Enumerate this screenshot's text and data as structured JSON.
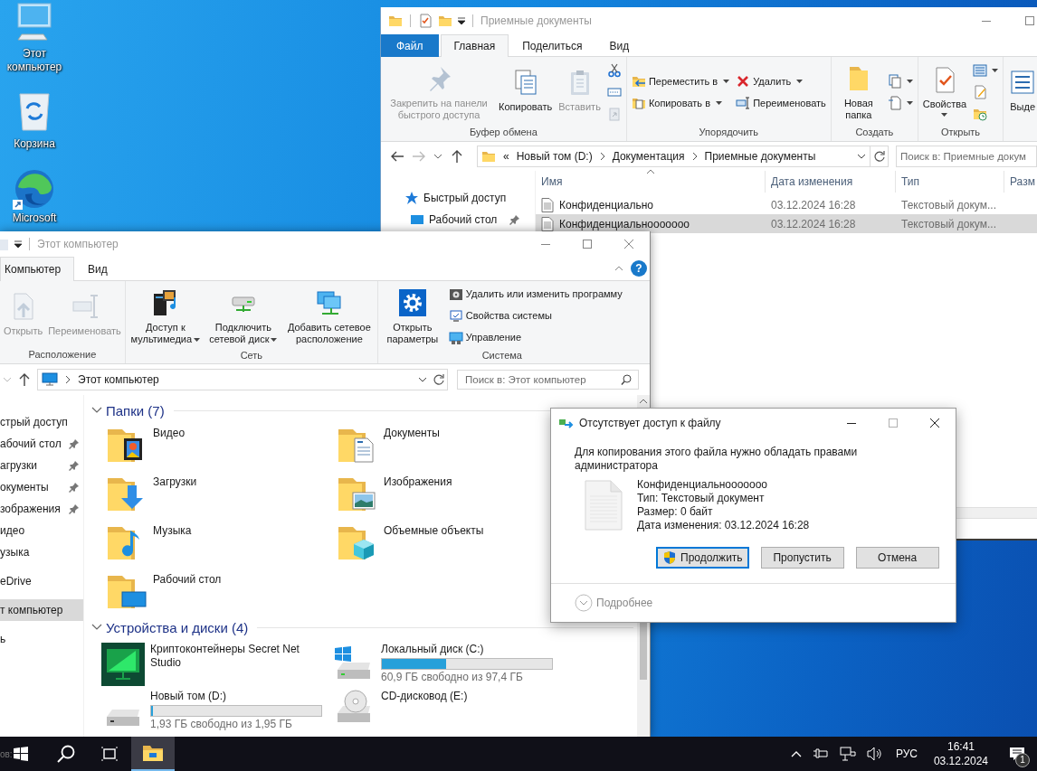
{
  "desktop": {
    "icons": [
      {
        "label": "Этот компьютер",
        "kind": "computer"
      },
      {
        "label": "Корзина",
        "kind": "bin"
      },
      {
        "label": "Microsoft",
        "kind": "browser"
      }
    ]
  },
  "documents_window": {
    "title": "Приемные документы",
    "tabs": [
      {
        "label": "Файл",
        "kind": "file",
        "selected": false
      },
      {
        "label": "Главная",
        "kind": "tab",
        "selected": true
      },
      {
        "label": "Поделиться",
        "kind": "tab",
        "selected": false
      },
      {
        "label": "Вид",
        "kind": "tab",
        "selected": false
      }
    ],
    "ribbon": [
      {
        "label": "Буфер обмена",
        "columns": [
          [
            {
              "kind": "large",
              "label": "Закрепить на панели быстрого доступа",
              "disabled": true,
              "menu": false
            }
          ],
          [
            {
              "kind": "large",
              "label": "Копировать",
              "disabled": false,
              "menu": false
            }
          ],
          [
            {
              "kind": "large",
              "label": "Вставить",
              "disabled": true,
              "menu": false
            }
          ],
          [
            {
              "kind": "icon",
              "disabled": false,
              "menu": false
            },
            {
              "kind": "icon",
              "disabled": false,
              "menu": false
            },
            {
              "kind": "icon",
              "disabled": true,
              "menu": false
            }
          ]
        ]
      },
      {
        "label": "Упорядочить",
        "columns": [
          [
            {
              "kind": "small",
              "label": "Переместить в",
              "disabled": false,
              "menu": true
            },
            {
              "kind": "small",
              "label": "Копировать в",
              "disabled": false,
              "menu": true
            }
          ],
          [
            {
              "kind": "small",
              "label": "Удалить",
              "disabled": false,
              "menu": true
            },
            {
              "kind": "small",
              "label": "Переименовать",
              "disabled": false,
              "menu": false
            }
          ]
        ]
      },
      {
        "label": "Создать",
        "columns": [
          [
            {
              "kind": "large",
              "label": "Новая папка",
              "disabled": false,
              "menu": false
            }
          ],
          [
            {
              "kind": "icon",
              "disabled": false,
              "menu": true
            },
            {
              "kind": "icon",
              "disabled": false,
              "menu": true
            }
          ]
        ]
      },
      {
        "label": "Открыть",
        "columns": [
          [
            {
              "kind": "large",
              "label": "Свойства",
              "disabled": false,
              "menu": true
            }
          ],
          [
            {
              "kind": "icon",
              "disabled": false,
              "menu": true
            },
            {
              "kind": "icon",
              "disabled": false,
              "menu": false
            },
            {
              "kind": "icon",
              "disabled": false,
              "menu": false
            }
          ]
        ]
      },
      {
        "columns": [
          [
            {
              "kind": "large",
              "label": "Выде",
              "disabled": false,
              "menu": false
            }
          ]
        ]
      }
    ],
    "address": {
      "overflow": "«",
      "path": [
        "Новый том (D:)",
        "Документация",
        "Приемные документы"
      ]
    },
    "search": {
      "placeholder": "Поиск в: Приемные докум"
    },
    "nav": [
      {
        "label": "Быстрый доступ",
        "kind": "quick",
        "pinned": false
      },
      {
        "label": "Рабочий стол",
        "kind": "desktop",
        "pinned": true
      }
    ],
    "columns": [
      "Имя",
      "Дата изменения",
      "Тип",
      "Разм"
    ],
    "rows": [
      {
        "name": "Конфиденциально",
        "modified": "03.12.2024 16:28",
        "type": "Текстовый докум...",
        "selected": false
      },
      {
        "name": "Конфиденциальнооооооо",
        "modified": "03.12.2024 16:28",
        "type": "Текстовый докум...",
        "selected": true
      }
    ]
  },
  "computer_window": {
    "title": "Этот компьютер",
    "tabs": [
      {
        "label": "Компьютер",
        "selected": true
      },
      {
        "label": "Вид",
        "selected": false
      }
    ],
    "help": "?",
    "ribbon": [
      {
        "label": "Расположение",
        "columns": [
          [
            {
              "kind": "large",
              "label": "Открыть",
              "disabled": true,
              "menu": false
            }
          ],
          [
            {
              "kind": "large",
              "label": "Переименовать",
              "disabled": true,
              "menu": false
            }
          ]
        ]
      },
      {
        "label": "Сеть",
        "columns": [
          [
            {
              "kind": "large",
              "label": "Доступ к мультимедиа",
              "disabled": false,
              "menu": true
            }
          ],
          [
            {
              "kind": "large",
              "label": "Подключить сетевой диск",
              "disabled": false,
              "menu": true
            }
          ],
          [
            {
              "kind": "large",
              "label": "Добавить сетевое расположение",
              "disabled": false,
              "menu": false
            }
          ]
        ]
      },
      {
        "label": "Система",
        "columns": [
          [
            {
              "kind": "large",
              "label": "Открыть параметры",
              "disabled": false,
              "menu": false
            }
          ],
          [
            {
              "kind": "small",
              "label": "Удалить или изменить программу",
              "disabled": false,
              "menu": false
            },
            {
              "kind": "small",
              "label": "Свойства системы",
              "disabled": false,
              "menu": false
            },
            {
              "kind": "small",
              "label": "Управление",
              "disabled": false,
              "menu": false
            }
          ]
        ]
      }
    ],
    "address": {
      "path": [
        "Этот компьютер"
      ]
    },
    "search": {
      "placeholder": "Поиск в: Этот компьютер"
    },
    "nav": [
      {
        "items": [
          {
            "label": "стрый доступ",
            "pinned": false,
            "selected": false
          },
          {
            "label": "абочий стол",
            "pinned": true,
            "selected": false
          },
          {
            "label": "агрузки",
            "pinned": true,
            "selected": false
          },
          {
            "label": "окументы",
            "pinned": true,
            "selected": false
          },
          {
            "label": "зображения",
            "pinned": true,
            "selected": false
          },
          {
            "label": "идео",
            "pinned": false,
            "selected": false
          },
          {
            "label": "узыка",
            "pinned": false,
            "selected": false
          }
        ]
      },
      {
        "items": [
          {
            "label": "eDrive",
            "pinned": false,
            "selected": false
          }
        ]
      },
      {
        "items": [
          {
            "label": "т компьютер",
            "pinned": false,
            "selected": true
          }
        ]
      },
      {
        "items": [
          {
            "label": "ь",
            "pinned": false,
            "selected": false
          }
        ]
      }
    ],
    "folders": {
      "title": "Папки (7)",
      "expanded": true,
      "items": [
        {
          "label": "Видео"
        },
        {
          "label": "Документы"
        },
        {
          "label": "Загрузки"
        },
        {
          "label": "Изображения"
        },
        {
          "label": "Музыка"
        },
        {
          "label": "Объемные объекты"
        },
        {
          "label": "Рабочий стол"
        }
      ]
    },
    "devices": {
      "title": "Устройства и диски (4)",
      "expanded": true,
      "items": [
        {
          "label": "Криптоконтейнеры Secret Net Studio",
          "kind": "app"
        },
        {
          "label": "Локальный диск (C:)",
          "kind": "system_drive",
          "level": 0.375,
          "free": "60,9 ГБ свободно из 97,4 ГБ"
        },
        {
          "label": "Новый том (D:)",
          "kind": "drive",
          "level": 0.01,
          "free": "1,93 ГБ свободно из 1,95 ГБ"
        },
        {
          "label": "CD-дисковод (E:)",
          "kind": "cd"
        }
      ]
    }
  },
  "dialog": {
    "title": "Отсутствует доступ к файлу",
    "message": "Для копирования этого файла нужно обладать правами администратора",
    "file": {
      "name": "Конфиденциальнооооооо",
      "details": [
        "Тип: Текстовый документ",
        "Размер: 0 байт",
        "Дата изменения: 03.12.2024 16:28"
      ]
    },
    "buttons": [
      {
        "label": "Продолжить",
        "kind": "elevated",
        "default": true
      },
      {
        "label": "Пропустить",
        "kind": "plain",
        "default": false
      },
      {
        "label": "Отмена",
        "kind": "plain",
        "default": false
      }
    ],
    "details_toggle": {
      "label": "Подробнее",
      "expanded": false
    }
  },
  "taskbar": {
    "left_text": "ов:",
    "apps": [
      {
        "kind": "start",
        "active": false
      },
      {
        "kind": "search",
        "active": false
      },
      {
        "kind": "taskview",
        "active": false
      },
      {
        "kind": "explorer",
        "active": true
      }
    ],
    "language": "РУС",
    "time": "16:41",
    "date": "03.12.2024",
    "notifications": "1"
  }
}
